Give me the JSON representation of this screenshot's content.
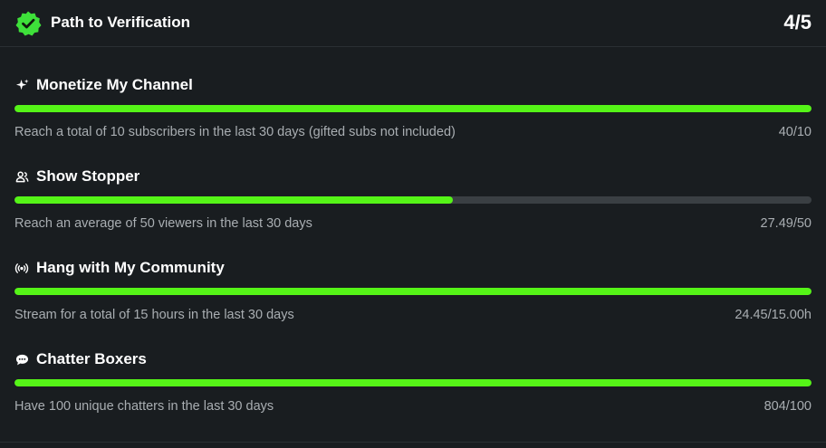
{
  "header": {
    "title": "Path to Verification",
    "count": "4/5",
    "badge_icon": "verified-badge-icon",
    "badge_color": "#3ee03a"
  },
  "colors": {
    "accent": "#55f417",
    "track": "#3a3f43",
    "muted_text": "#a9aeb2",
    "background": "#191d20"
  },
  "goals": [
    {
      "icon": "sparkle-icon",
      "title": "Monetize My Channel",
      "description": "Reach a total of 10 subscribers in the last 30 days (gifted subs not included)",
      "value": "40/10",
      "progress": 1.0
    },
    {
      "icon": "viewers-icon",
      "title": "Show Stopper",
      "description": "Reach an average of 50 viewers in the last 30 days",
      "value": "27.49/50",
      "progress": 0.5498
    },
    {
      "icon": "broadcast-icon",
      "title": "Hang with My Community",
      "description": "Stream for a total of 15 hours in the last 30 days",
      "value": "24.45/15.00h",
      "progress": 1.0
    },
    {
      "icon": "chat-bubble-icon",
      "title": "Chatter Boxers",
      "description": "Have 100 unique chatters in the last 30 days",
      "value": "804/100",
      "progress": 1.0
    }
  ]
}
